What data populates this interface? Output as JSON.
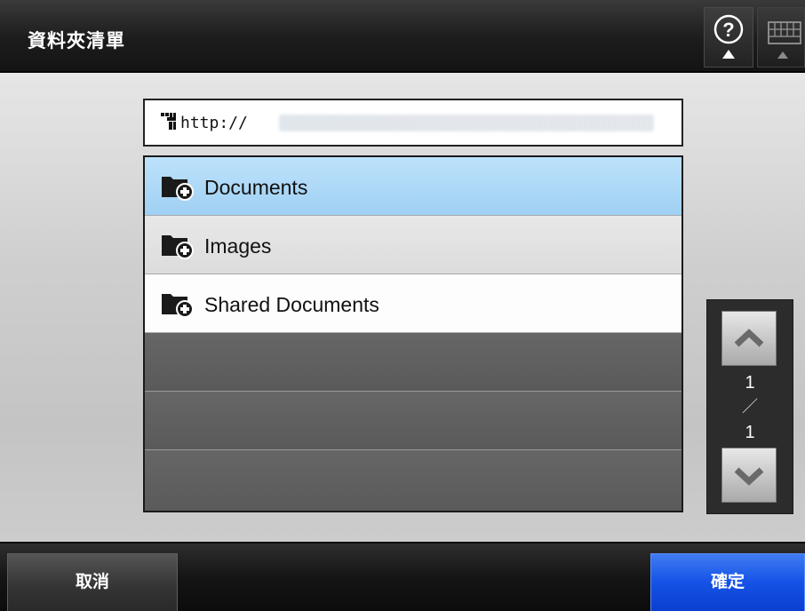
{
  "window": {
    "title": "資料夾清單"
  },
  "header": {
    "help_icon": "help-question-icon",
    "keyboard_icon": "keyboard-icon"
  },
  "url_field": {
    "prefix": "http://",
    "icon": "sharepoint-site-icon"
  },
  "folders": [
    {
      "label": "Documents",
      "icon": "shared-folder-icon",
      "state": "selected"
    },
    {
      "label": "Images",
      "icon": "shared-folder-icon",
      "state": "normal"
    },
    {
      "label": "Shared Documents",
      "icon": "shared-folder-icon",
      "state": "normal"
    }
  ],
  "pager": {
    "current": "1",
    "separator": "／",
    "total": "1"
  },
  "buttons": {
    "cancel": "取消",
    "ok": "確定"
  },
  "colors": {
    "selected_row": "#a9d6f5",
    "alt_row": "#e2e2e2",
    "normal_row": "#ffffff",
    "ok_button": "#1552e6"
  }
}
